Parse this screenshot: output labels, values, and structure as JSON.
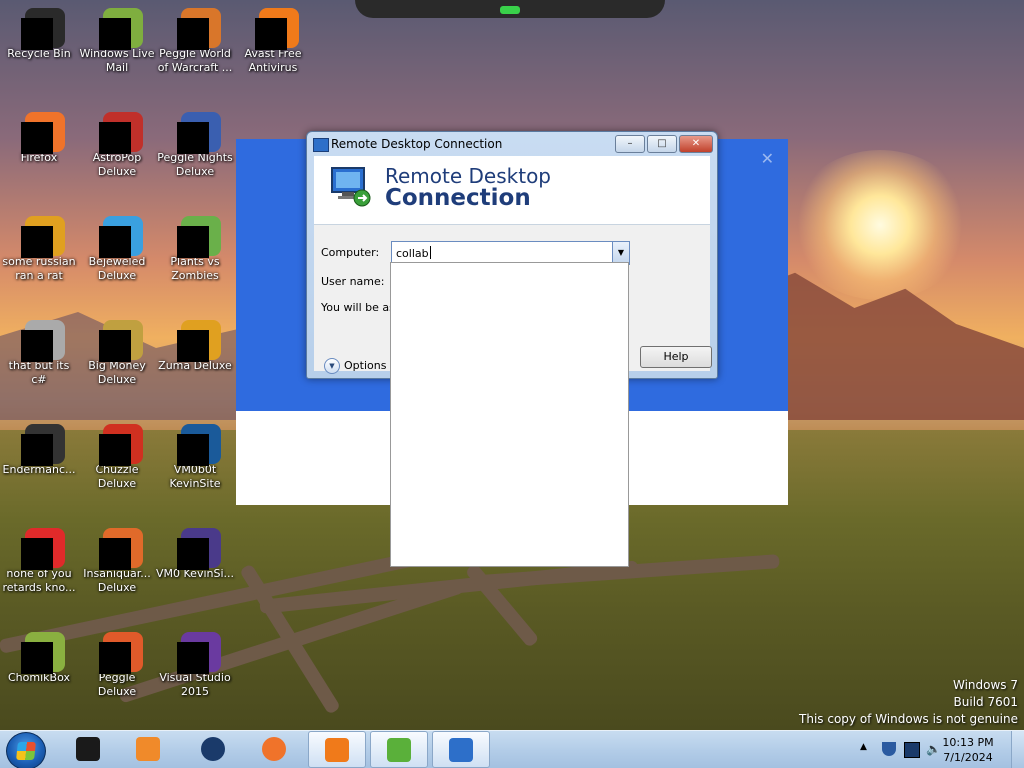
{
  "desktop": {
    "icons": [
      {
        "label": "Recycle Bin",
        "icon": "recycle-bin-icon",
        "color": "#2a2a2a"
      },
      {
        "label": "Windows Live Mail",
        "icon": "mail-icon",
        "color": "#7fae3f"
      },
      {
        "label": "Peggle World of Warcraft ...",
        "icon": "peggle-wow-icon",
        "color": "#d9762a"
      },
      {
        "label": "Avast Free Antivirus",
        "icon": "avast-icon",
        "color": "#f07a1a"
      },
      {
        "label": "Firefox",
        "icon": "firefox-icon",
        "color": "#f0732a"
      },
      {
        "label": "AstroPop Deluxe",
        "icon": "astropop-icon",
        "color": "#c0302a"
      },
      {
        "label": "Peggle Nights Deluxe",
        "icon": "peggle-nights-icon",
        "color": "#3a5fb0"
      },
      {
        "label": "some russian ran a rat",
        "icon": "app-icon",
        "color": "#e0a020"
      },
      {
        "label": "Bejeweled Deluxe",
        "icon": "bejeweled-icon",
        "color": "#3aa0e0"
      },
      {
        "label": "Plants vs Zombies",
        "icon": "pvz-icon",
        "color": "#6ab04a"
      },
      {
        "label": "that but its c#",
        "icon": "folder-icon",
        "color": "#aaaaaa"
      },
      {
        "label": "Big Money Deluxe",
        "icon": "bigmoney-icon",
        "color": "#c0a040"
      },
      {
        "label": "Zuma Deluxe",
        "icon": "zuma-icon",
        "color": "#e0a020"
      },
      {
        "label": "Endermanc...",
        "icon": "app-icon",
        "color": "#333333"
      },
      {
        "label": "Chuzzle Deluxe",
        "icon": "chuzzle-icon",
        "color": "#d03020"
      },
      {
        "label": "VM0b0t KevinSite",
        "icon": "vm-icon",
        "color": "#1a5a9a"
      },
      {
        "label": "none of you retards kno...",
        "icon": "app-icon",
        "color": "#e02a2a"
      },
      {
        "label": "Insaniquar... Deluxe",
        "icon": "insaniquarium-icon",
        "color": "#e06a2a"
      },
      {
        "label": "VM0 KevinSi...",
        "icon": "vm-icon",
        "color": "#4a3a8a"
      },
      {
        "label": "ChomikBox",
        "icon": "chomikbox-icon",
        "color": "#8ab040"
      },
      {
        "label": "Peggle Deluxe",
        "icon": "peggle-icon",
        "color": "#e05a2a"
      },
      {
        "label": "Visual Studio 2015",
        "icon": "visual-studio-icon",
        "color": "#6a3aa0"
      }
    ]
  },
  "rdc": {
    "title": "Remote Desktop Connection",
    "banner_line1": "Remote Desktop",
    "banner_line2": "Connection",
    "minimize": "–",
    "maximize": "□",
    "close": "✕",
    "computer_label": "Computer:",
    "computer_value": "collab",
    "username_label": "User name:",
    "info_text": "You will be ask",
    "options_label": "Options",
    "help_label": "Help"
  },
  "watermark": {
    "line1": "Windows 7",
    "line2": "Build 7601",
    "line3": "This copy of Windows is not genuine"
  },
  "taskbar": {
    "time": "10:13 PM",
    "date": "7/1/2024",
    "items": [
      {
        "icon": "app-icon",
        "color": "#1a1a1a"
      },
      {
        "icon": "media-player-icon",
        "color": "#f08a2a"
      },
      {
        "icon": "globe-icon",
        "color": "#1a3a6a"
      },
      {
        "icon": "firefox-icon",
        "color": "#f0732a"
      },
      {
        "icon": "avast-icon",
        "color": "#f07a1a"
      },
      {
        "icon": "install-icon",
        "color": "#5ab03a"
      },
      {
        "icon": "remote-desktop-icon",
        "color": "#2d6fc9"
      }
    ]
  }
}
